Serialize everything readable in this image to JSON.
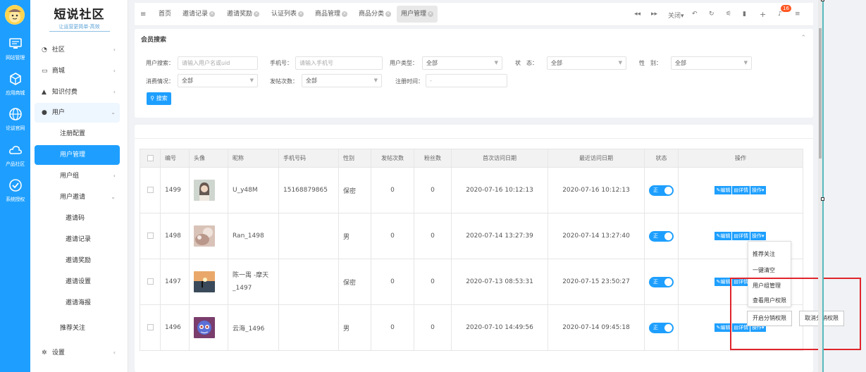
{
  "leftbar": {
    "items": [
      {
        "label": "网站管理",
        "icon": "monitor-icon"
      },
      {
        "label": "应用商城",
        "icon": "cube-icon"
      },
      {
        "label": "论谈官网",
        "icon": "globe-icon"
      },
      {
        "label": "产品社区",
        "icon": "cloud-icon"
      },
      {
        "label": "系统授权",
        "icon": "check-circle-icon"
      }
    ]
  },
  "brand": {
    "title": "短说社区",
    "subtitle": "让运营更简单·高效"
  },
  "menu": {
    "items": [
      {
        "label": "社区",
        "arrow": "‹"
      },
      {
        "label": "商城",
        "arrow": "‹"
      },
      {
        "label": "知识付费",
        "arrow": "‹"
      },
      {
        "label": "用户",
        "arrow": "⌄"
      },
      {
        "label": "注册配置"
      },
      {
        "label": "用户管理"
      },
      {
        "label": "用户组",
        "arrow": "‹"
      },
      {
        "label": "用户邀请",
        "arrow": "⌄"
      },
      {
        "label": "邀请码"
      },
      {
        "label": "邀请记录"
      },
      {
        "label": "邀请奖励"
      },
      {
        "label": "邀请设置"
      },
      {
        "label": "邀请海报"
      },
      {
        "label": "推荐关注"
      },
      {
        "label": "设置",
        "arrow": "‹"
      }
    ]
  },
  "tabs": [
    {
      "label": "首页"
    },
    {
      "label": "邀请记录"
    },
    {
      "label": "邀请奖励"
    },
    {
      "label": "认证列表"
    },
    {
      "label": "商品管理"
    },
    {
      "label": "商品分类"
    },
    {
      "label": "用户管理"
    }
  ],
  "topbar": {
    "close_label": "关闭▾",
    "badge": "16"
  },
  "search": {
    "title": "会员搜索",
    "user_search_label": "用户搜索：",
    "user_search_placeholder": "请输入用户名或uid",
    "phone_label": "手机号：",
    "phone_placeholder": "请输入手机号",
    "user_type_label": "用户类型：",
    "user_type_value": "全部",
    "status_label": "状　态：",
    "status_value": "全部",
    "gender_label": "性　别：",
    "gender_value": "全部",
    "consume_label": "消费情况：",
    "consume_value": "全部",
    "post_label": "发帖次数：",
    "post_value": "全部",
    "reg_label": "注册时间：",
    "reg_placeholder": "-",
    "button": "搜索"
  },
  "table": {
    "headers": [
      "编号",
      "头像",
      "昵称",
      "手机号码",
      "性别",
      "发帖次数",
      "粉丝数",
      "首次访问日期",
      "最近访问日期",
      "状态",
      "操作"
    ],
    "rows": [
      {
        "id": "1499",
        "nick": "U_y48M",
        "phone": "15168879865",
        "gender": "保密",
        "posts": "0",
        "fans": "0",
        "first": "2020-07-16 10:12:13",
        "last": "2020-07-16 10:12:13",
        "status": "正"
      },
      {
        "id": "1498",
        "nick": "Ran_1498",
        "phone": "",
        "gender": "男",
        "posts": "0",
        "fans": "0",
        "first": "2020-07-14 13:27:39",
        "last": "2020-07-14 13:27:40",
        "status": "正"
      },
      {
        "id": "1497",
        "nick": "陈一禺 -摩天_1497",
        "phone": "",
        "gender": "保密",
        "posts": "0",
        "fans": "0",
        "first": "2020-07-13 08:53:31",
        "last": "2020-07-15 23:50:27",
        "status": "正"
      },
      {
        "id": "1496",
        "nick": "云海_1496",
        "phone": "",
        "gender": "男",
        "posts": "0",
        "fans": "0",
        "first": "2020-07-10 14:49:56",
        "last": "2020-07-14 09:45:18",
        "status": "正"
      }
    ],
    "actions": {
      "edit": "编辑",
      "detail": "详情",
      "op": "操作"
    }
  },
  "dropdown": {
    "items": [
      "推荐关注",
      "一键清空",
      "用户组管理",
      "查看用户权限"
    ]
  },
  "distribution": {
    "enable": "开启分销权限",
    "disable": "取消分销权限"
  },
  "colors": {
    "primary": "#1e9fff",
    "highlight_box": "#e0242b"
  }
}
